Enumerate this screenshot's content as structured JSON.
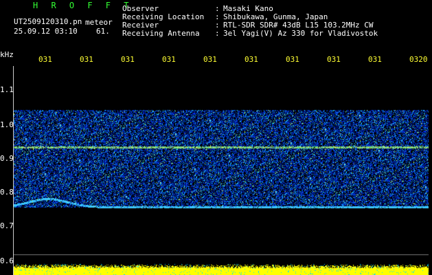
{
  "header": {
    "title": "H R O F F T",
    "filename": "UT2509120310.pn",
    "meteor_label": "meteor",
    "datetime": "25.09.12 03:10",
    "count": "61."
  },
  "info": [
    {
      "key": "Observer",
      "value": "Masaki Kano"
    },
    {
      "key": "Receiving Location",
      "value": "Shibukawa, Gunma, Japan"
    },
    {
      "key": "Receiver",
      "value": "RTL-SDR SDR# 43dB L15 103.2MHz CW"
    },
    {
      "key": "Receiving Antenna",
      "value": "3el Yagi(V) Az 330 for Vladivostok"
    }
  ],
  "axis": {
    "unit": "kHz",
    "time_ticks": [
      "031",
      "031",
      "031",
      "031",
      "031",
      "031",
      "031",
      "031",
      "031",
      "0320"
    ],
    "freq_ticks": [
      "1.1",
      "1.0",
      "0.9",
      "0.8",
      "0.7",
      "0.6"
    ]
  },
  "colors": {
    "background": "#000000",
    "header_green": "#33ff33",
    "tick_yellow": "#ffff33",
    "signal_blue": "#1030ff",
    "carrier_yellow": "#ffff33"
  }
}
